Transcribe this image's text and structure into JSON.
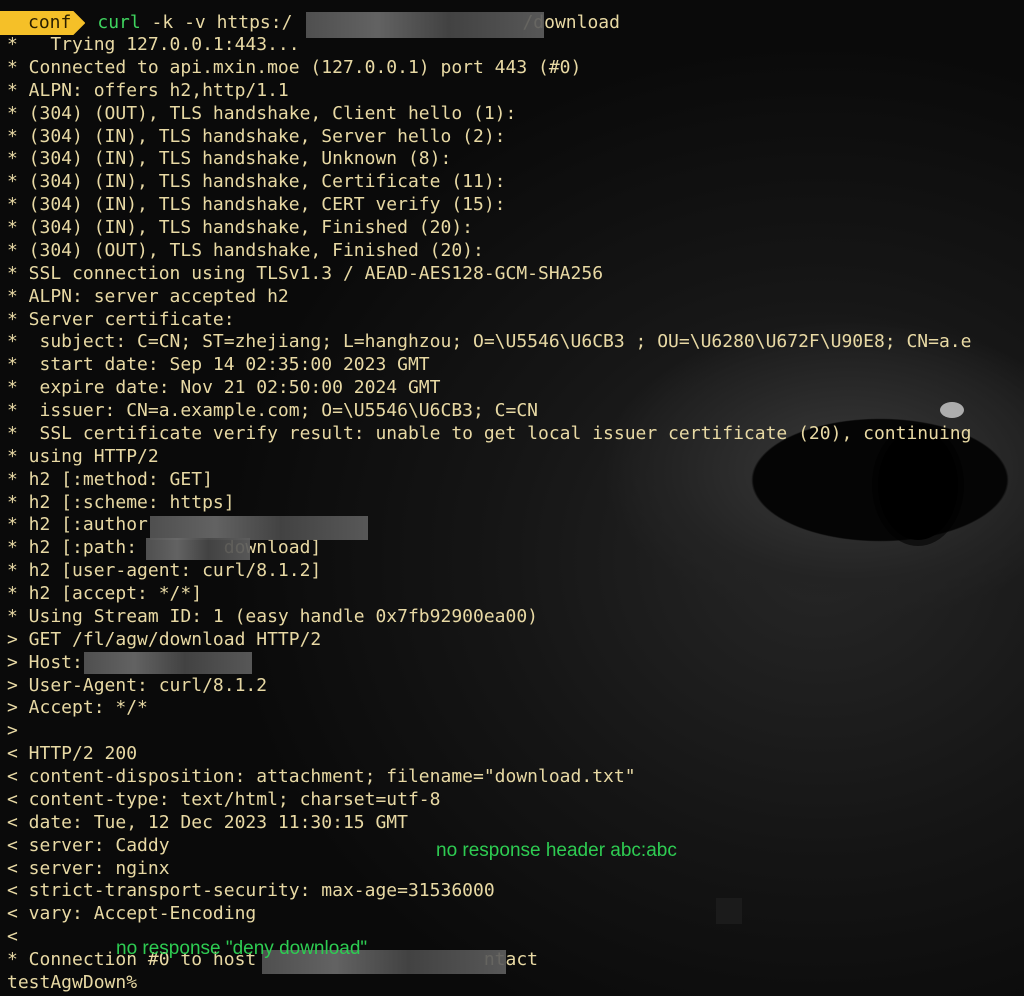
{
  "prompt": {
    "badge": "conf",
    "cmd_name": "curl",
    "cmd_args": " -k -v https:/",
    "cmd_tail": "/download"
  },
  "lines": [
    "*   Trying 127.0.0.1:443...",
    "* Connected to api.mxin.moe (127.0.0.1) port 443 (#0)",
    "* ALPN: offers h2,http/1.1",
    "* (304) (OUT), TLS handshake, Client hello (1):",
    "* (304) (IN), TLS handshake, Server hello (2):",
    "* (304) (IN), TLS handshake, Unknown (8):",
    "* (304) (IN), TLS handshake, Certificate (11):",
    "* (304) (IN), TLS handshake, CERT verify (15):",
    "* (304) (IN), TLS handshake, Finished (20):",
    "* (304) (OUT), TLS handshake, Finished (20):",
    "* SSL connection using TLSv1.3 / AEAD-AES128-GCM-SHA256",
    "* ALPN: server accepted h2",
    "* Server certificate:",
    "*  subject: C=CN; ST=zhejiang; L=hanghzou; O=\\U5546\\U6CB3 ; OU=\\U6280\\U672F\\U90E8; CN=a.e",
    "*  start date: Sep 14 02:35:00 2023 GMT",
    "*  expire date: Nov 21 02:50:00 2024 GMT",
    "*  issuer: CN=a.example.com; O=\\U5546\\U6CB3; C=CN",
    "*  SSL certificate verify result: unable to get local issuer certificate (20), continuing",
    "* using HTTP/2",
    "* h2 [:method: GET]",
    "* h2 [:scheme: https]",
    "* h2 [:author",
    "* h2 [:path:        download]",
    "* h2 [user-agent: curl/8.1.2]",
    "* h2 [accept: */*]",
    "* Using Stream ID: 1 (easy handle 0x7fb92900ea00)",
    "> GET /fl/agw/download HTTP/2",
    "> Host:",
    "> User-Agent: curl/8.1.2",
    "> Accept: */*",
    ">",
    "< HTTP/2 200",
    "< content-disposition: attachment; filename=\"download.txt\"",
    "< content-type: text/html; charset=utf-8",
    "< date: Tue, 12 Dec 2023 11:30:15 GMT",
    "< server: Caddy",
    "< server: nginx",
    "< strict-transport-security: max-age=31536000",
    "< vary: Accept-Encoding",
    "<",
    "* Connection #0 to host                     ntact",
    "testAgwDown"
  ],
  "cursor_mark": "%",
  "annotations": {
    "no_header": "no response header abc:abc",
    "no_deny": "no response \"deny download\""
  },
  "colors": {
    "badge": "#f5c028",
    "command": "#3fd45f",
    "output": "#e8d9a4",
    "annotation": "#2ecc52"
  }
}
